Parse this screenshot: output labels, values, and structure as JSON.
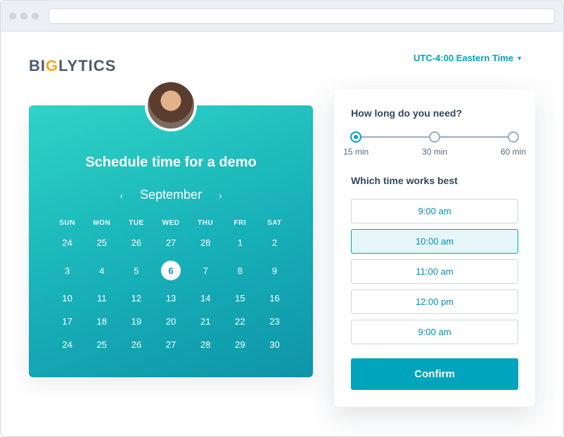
{
  "timezone": "UTC-4:00 Eastern Time",
  "brand": {
    "prefix": "BI",
    "accent": "G",
    "suffix": "LYTICS"
  },
  "calendar": {
    "title": "Schedule time for a demo",
    "month": "September",
    "dow": [
      "SUN",
      "MON",
      "TUE",
      "WED",
      "THU",
      "FRI",
      "SAT"
    ],
    "rows": [
      [
        "24",
        "25",
        "26",
        "27",
        "28",
        "1",
        "2"
      ],
      [
        "3",
        "4",
        "5",
        "6",
        "7",
        "8",
        "9"
      ],
      [
        "10",
        "11",
        "12",
        "13",
        "14",
        "15",
        "16"
      ],
      [
        "17",
        "18",
        "19",
        "20",
        "21",
        "22",
        "23"
      ],
      [
        "24",
        "25",
        "26",
        "27",
        "28",
        "29",
        "30"
      ]
    ],
    "selected": "6"
  },
  "duration": {
    "question": "How long do you need?",
    "options": [
      "15 min",
      "30 min",
      "60 min"
    ],
    "selected_index": 0
  },
  "timeslots": {
    "question": "Which time works best",
    "options": [
      "9:00 am",
      "10:00 am",
      "11:00 am",
      "12:00 pm",
      "9:00 am"
    ],
    "selected_index": 1
  },
  "confirm_label": "Confirm"
}
